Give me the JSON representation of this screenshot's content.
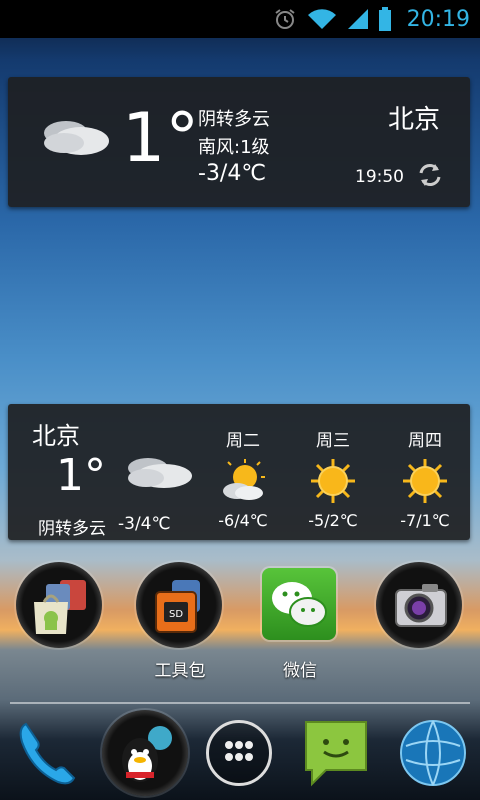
{
  "status_bar": {
    "time": "20:19",
    "icons": [
      "alarm-icon",
      "wifi-icon",
      "signal-icon",
      "battery-icon"
    ]
  },
  "weather_widget_1": {
    "temperature": "1°",
    "condition": "阴转多云",
    "wind": "南风:1级",
    "range": "-3/4℃",
    "city": "北京",
    "updated": "19:50"
  },
  "weather_widget_2": {
    "city": "北京",
    "temperature": "1°",
    "condition": "阴转多云",
    "range": "-3/4℃",
    "forecast": [
      {
        "day": "周二",
        "range": "-6/4℃",
        "icon": "partly-sunny-icon"
      },
      {
        "day": "周三",
        "range": "-5/2℃",
        "icon": "sunny-icon"
      },
      {
        "day": "周四",
        "range": "-7/1℃",
        "icon": "sunny-icon"
      }
    ]
  },
  "home_apps": [
    {
      "name": "store-folder-icon",
      "label": ""
    },
    {
      "name": "toolbox-icon",
      "label": "工具包"
    },
    {
      "name": "wechat-icon",
      "label": "微信"
    },
    {
      "name": "camera-icon",
      "label": ""
    }
  ],
  "dock": [
    "phone-icon",
    "qq-icon",
    "app-drawer-icon",
    "messages-icon",
    "browser-icon"
  ],
  "colors": {
    "status_time": "#33b5e5",
    "widget_bg": "#1e2022"
  }
}
